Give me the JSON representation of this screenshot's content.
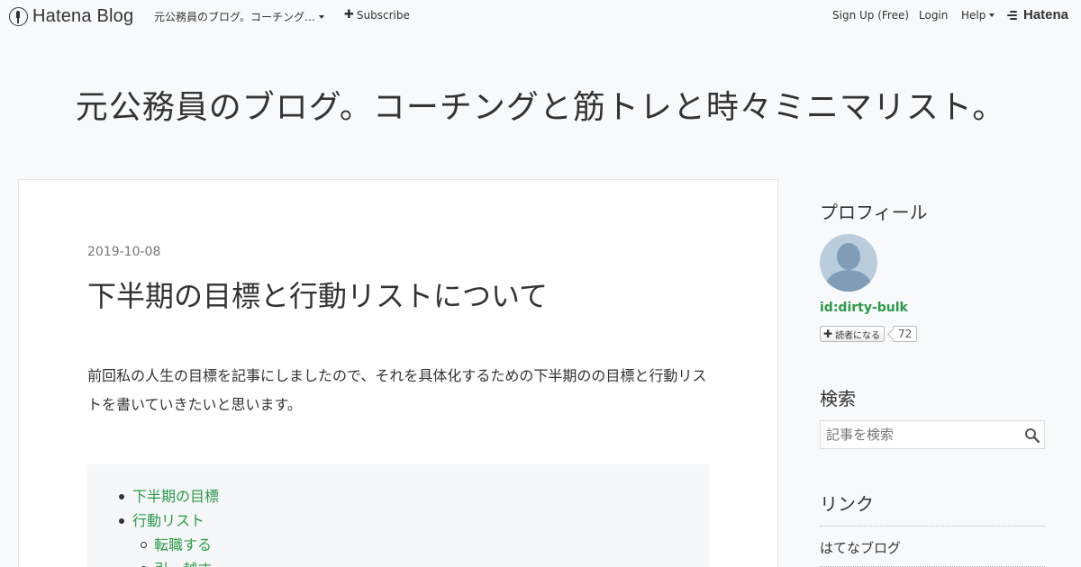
{
  "topbar": {
    "brand": "Hatena Blog",
    "blog_dropdown": "元公務員のブログ。コーチング…",
    "subscribe": "Subscribe",
    "sign_up": "Sign Up (Free)",
    "login": "Login",
    "help": "Help",
    "hatena": "Hatena"
  },
  "blog": {
    "title": "元公務員のブログ。コーチングと筋トレと時々ミニマリスト。"
  },
  "article": {
    "date": "2019-10-08",
    "title": "下半期の目標と行動リストについて",
    "intro": "前回私の人生の目標を記事にしましたので、それを具体化するための下半期のの目標と行動リストを書いていきたいと思います。",
    "toc": {
      "items": [
        {
          "label": "下半期の目標"
        },
        {
          "label": "行動リスト",
          "children": [
            {
              "label": "転職する"
            },
            {
              "label": "引っ越す"
            }
          ]
        }
      ]
    }
  },
  "sidebar": {
    "profile_heading": "プロフィール",
    "profile_id": "id:dirty-bulk",
    "follow_label": "読者になる",
    "follow_count": "72",
    "search_heading": "検索",
    "search_placeholder": "記事を検索",
    "links_heading": "リンク",
    "links": [
      "はてなブログ"
    ]
  },
  "colors": {
    "link_green": "#2b9a49",
    "page_bg": "#f8f9fa"
  }
}
